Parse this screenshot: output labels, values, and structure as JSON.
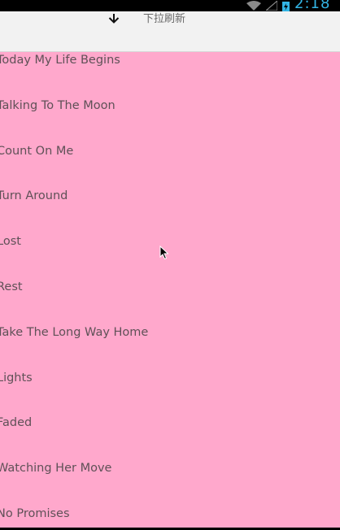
{
  "status_bar": {
    "time": "2:18",
    "icons": [
      "wifi-icon",
      "signal-icon",
      "battery-charging-icon"
    ],
    "accent_color": "#33b5e5"
  },
  "pull_header": {
    "arrow_icon": "arrow-down-icon",
    "text": "下拉刷新"
  },
  "list": {
    "background_color": "#ffa8cc",
    "items": [
      "Today My Life Begins",
      "Talking To The Moon",
      "Count On Me",
      "Turn Around",
      "Lost",
      "Rest",
      "Take The Long Way Home",
      "Lights",
      "Faded",
      "Watching Her Move",
      "No Promises"
    ]
  }
}
